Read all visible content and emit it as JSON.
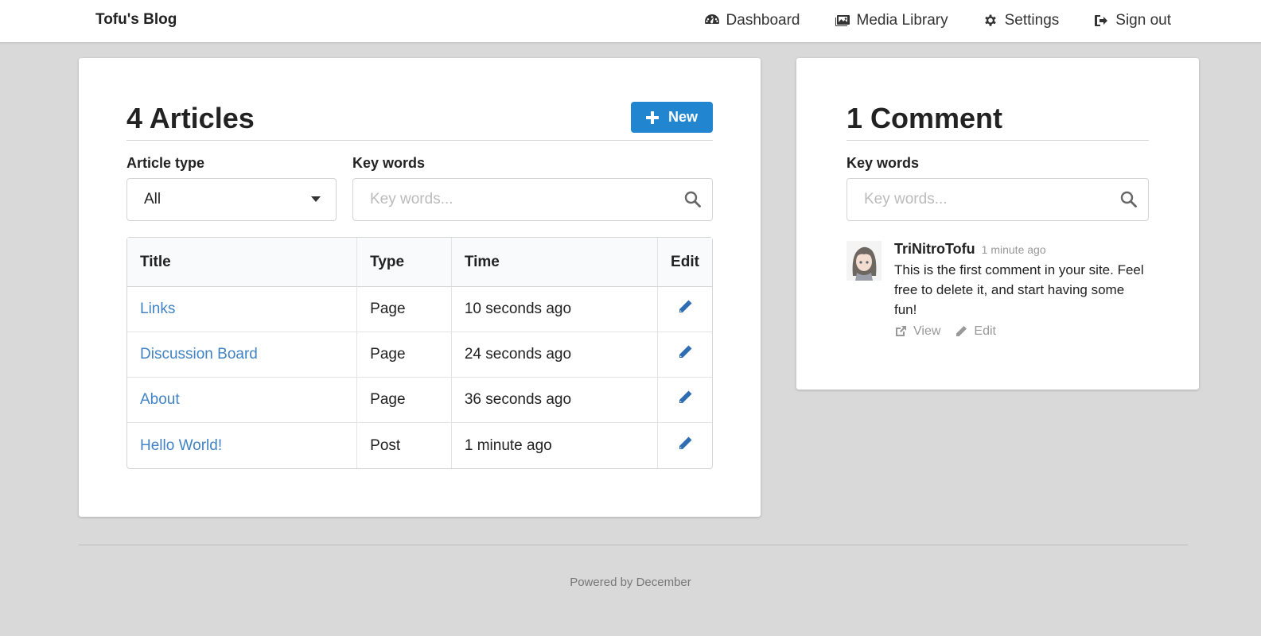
{
  "header": {
    "brand": "Tofu's Blog",
    "nav": [
      {
        "label": "Dashboard",
        "icon": "dashboard-icon"
      },
      {
        "label": "Media Library",
        "icon": "images-icon"
      },
      {
        "label": "Settings",
        "icon": "gear-icon"
      },
      {
        "label": "Sign out",
        "icon": "sign-out-icon"
      }
    ]
  },
  "articles": {
    "title": "4 Articles",
    "new_label": "New",
    "type_label": "Article type",
    "type_value": "All",
    "keywords_label": "Key words",
    "keywords_placeholder": "Key words...",
    "columns": [
      "Title",
      "Type",
      "Time",
      "Edit"
    ],
    "rows": [
      {
        "title": "Links",
        "type": "Page",
        "time": "10 seconds ago"
      },
      {
        "title": "Discussion Board",
        "type": "Page",
        "time": "24 seconds ago"
      },
      {
        "title": "About",
        "type": "Page",
        "time": "36 seconds ago"
      },
      {
        "title": "Hello World!",
        "type": "Post",
        "time": "1 minute ago"
      }
    ]
  },
  "comments": {
    "title": "1 Comment",
    "keywords_label": "Key words",
    "keywords_placeholder": "Key words...",
    "items": [
      {
        "author": "TriNitroTofu",
        "time": "1 minute ago",
        "text": "This is the first comment in your site. Feel free to delete it, and start having some fun!",
        "view_label": "View",
        "edit_label": "Edit"
      }
    ]
  },
  "footer": {
    "text": "Powered by December"
  },
  "colors": {
    "primary": "#2185d0",
    "link": "#4183c4",
    "background": "#d9d9d9"
  }
}
